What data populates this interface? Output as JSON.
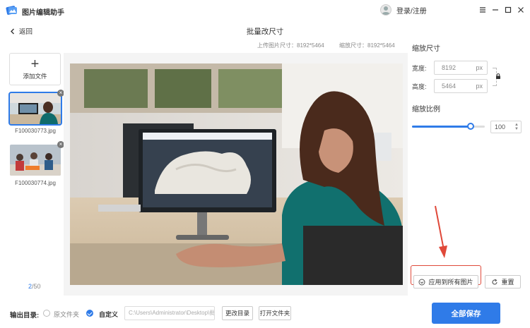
{
  "app": {
    "title": "图片编辑助手",
    "login_label": "登录/注册"
  },
  "nav": {
    "back_label": "返回",
    "page_title": "批量改尺寸"
  },
  "info": {
    "upload_size": "上传图片尺寸：8192*5464",
    "scaled_size": "缩放尺寸：8192*5464"
  },
  "files": {
    "add_label": "添加文件",
    "items": [
      {
        "name": "F100030773.jpg",
        "selected": true
      },
      {
        "name": "F100030774.jpg",
        "selected": false
      }
    ],
    "page_current": "2",
    "page_total": "/50"
  },
  "resize": {
    "title": "缩放尺寸",
    "width_label": "宽度:",
    "width_value": "8192",
    "height_label": "高度:",
    "height_value": "5464",
    "unit": "px",
    "scale_title": "缩放比例",
    "scale_value": "100",
    "scale_fraction": 0.81
  },
  "actions": {
    "apply_label": "应用到所有图片",
    "reset_label": "重置"
  },
  "output": {
    "label": "输出目录:",
    "option_original": "原文件夹",
    "option_custom": "自定义",
    "path": "C:\\Users\\Administrator\\Desktop\\批",
    "change_dir": "更改目录",
    "open_folder": "打开文件夹",
    "save_all": "全部保存"
  },
  "colors": {
    "accent": "#2f7be8",
    "highlight": "#e0493a"
  }
}
